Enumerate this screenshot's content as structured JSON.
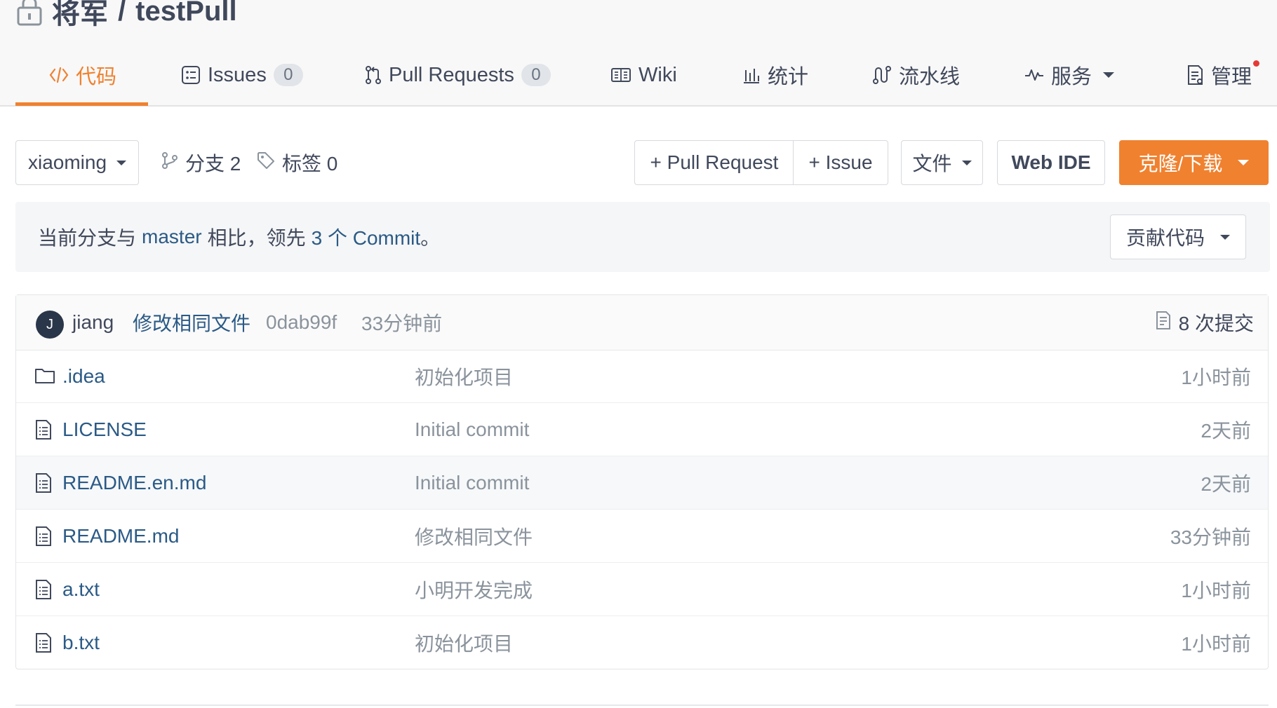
{
  "repo": {
    "owner": "将军",
    "sep": "/",
    "name": "testPull"
  },
  "tabs": [
    {
      "label": "代码",
      "icon": "code-icon"
    },
    {
      "label": "Issues",
      "count": "0",
      "icon": "issues-icon"
    },
    {
      "label": "Pull Requests",
      "count": "0",
      "icon": "pull-request-icon"
    },
    {
      "label": "Wiki",
      "icon": "wiki-icon"
    },
    {
      "label": "统计",
      "icon": "stats-icon"
    },
    {
      "label": "流水线",
      "icon": "pipeline-icon"
    },
    {
      "label": "服务",
      "icon": "services-icon"
    },
    {
      "label": "管理",
      "icon": "manage-icon"
    }
  ],
  "toolbar": {
    "branch": "xiaoming",
    "branches_label": "分支 2",
    "tags_label": "标签 0",
    "new_pr": "+ Pull Request",
    "new_issue": "+ Issue",
    "file": "文件",
    "web_ide": "Web IDE",
    "clone": "克隆/下载"
  },
  "compare": {
    "prefix": "当前分支与",
    "base": "master",
    "mid": "相比，领先",
    "count": "3 个 Commit",
    "suffix": "。",
    "contribute": "贡献代码"
  },
  "latest_commit": {
    "avatar": "J",
    "author": "jiang",
    "message": "修改相同文件",
    "sha": "0dab99f",
    "time": "33分钟前",
    "commits": "8 次提交"
  },
  "files": [
    {
      "type": "folder",
      "name": ".idea",
      "message": "初始化项目",
      "time": "1小时前"
    },
    {
      "type": "file",
      "name": "LICENSE",
      "message": "Initial commit",
      "time": "2天前"
    },
    {
      "type": "file",
      "name": "README.en.md",
      "message": "Initial commit",
      "time": "2天前"
    },
    {
      "type": "file",
      "name": "README.md",
      "message": "修改相同文件",
      "time": "33分钟前"
    },
    {
      "type": "file",
      "name": "a.txt",
      "message": "小明开发完成",
      "time": "1小时前"
    },
    {
      "type": "file",
      "name": "b.txt",
      "message": "初始化项目",
      "time": "1小时前"
    }
  ],
  "colors": {
    "accent": "#f0812f",
    "link": "#2b5a86",
    "muted": "#8a939c",
    "text": "#40485b"
  }
}
